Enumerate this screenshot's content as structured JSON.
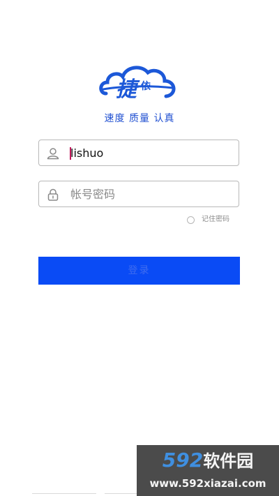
{
  "logo": {
    "brand_char_main": "捷",
    "brand_char_small": "依"
  },
  "slogan": "速度 质量 认真",
  "username": {
    "value": "lishuo",
    "icon": "user-icon"
  },
  "password": {
    "placeholder": "帐号密码",
    "icon": "lock-icon"
  },
  "remember": {
    "label": "记住密码",
    "checked": false
  },
  "login_button": {
    "label": "登录"
  },
  "watermark": {
    "brand_num": "592",
    "brand_text": "软件园",
    "url": "www.592xiazai.com"
  },
  "colors": {
    "accent": "#0a4bf5",
    "slogan": "#1f4fd1",
    "logo_blue": "#1c58d8"
  }
}
